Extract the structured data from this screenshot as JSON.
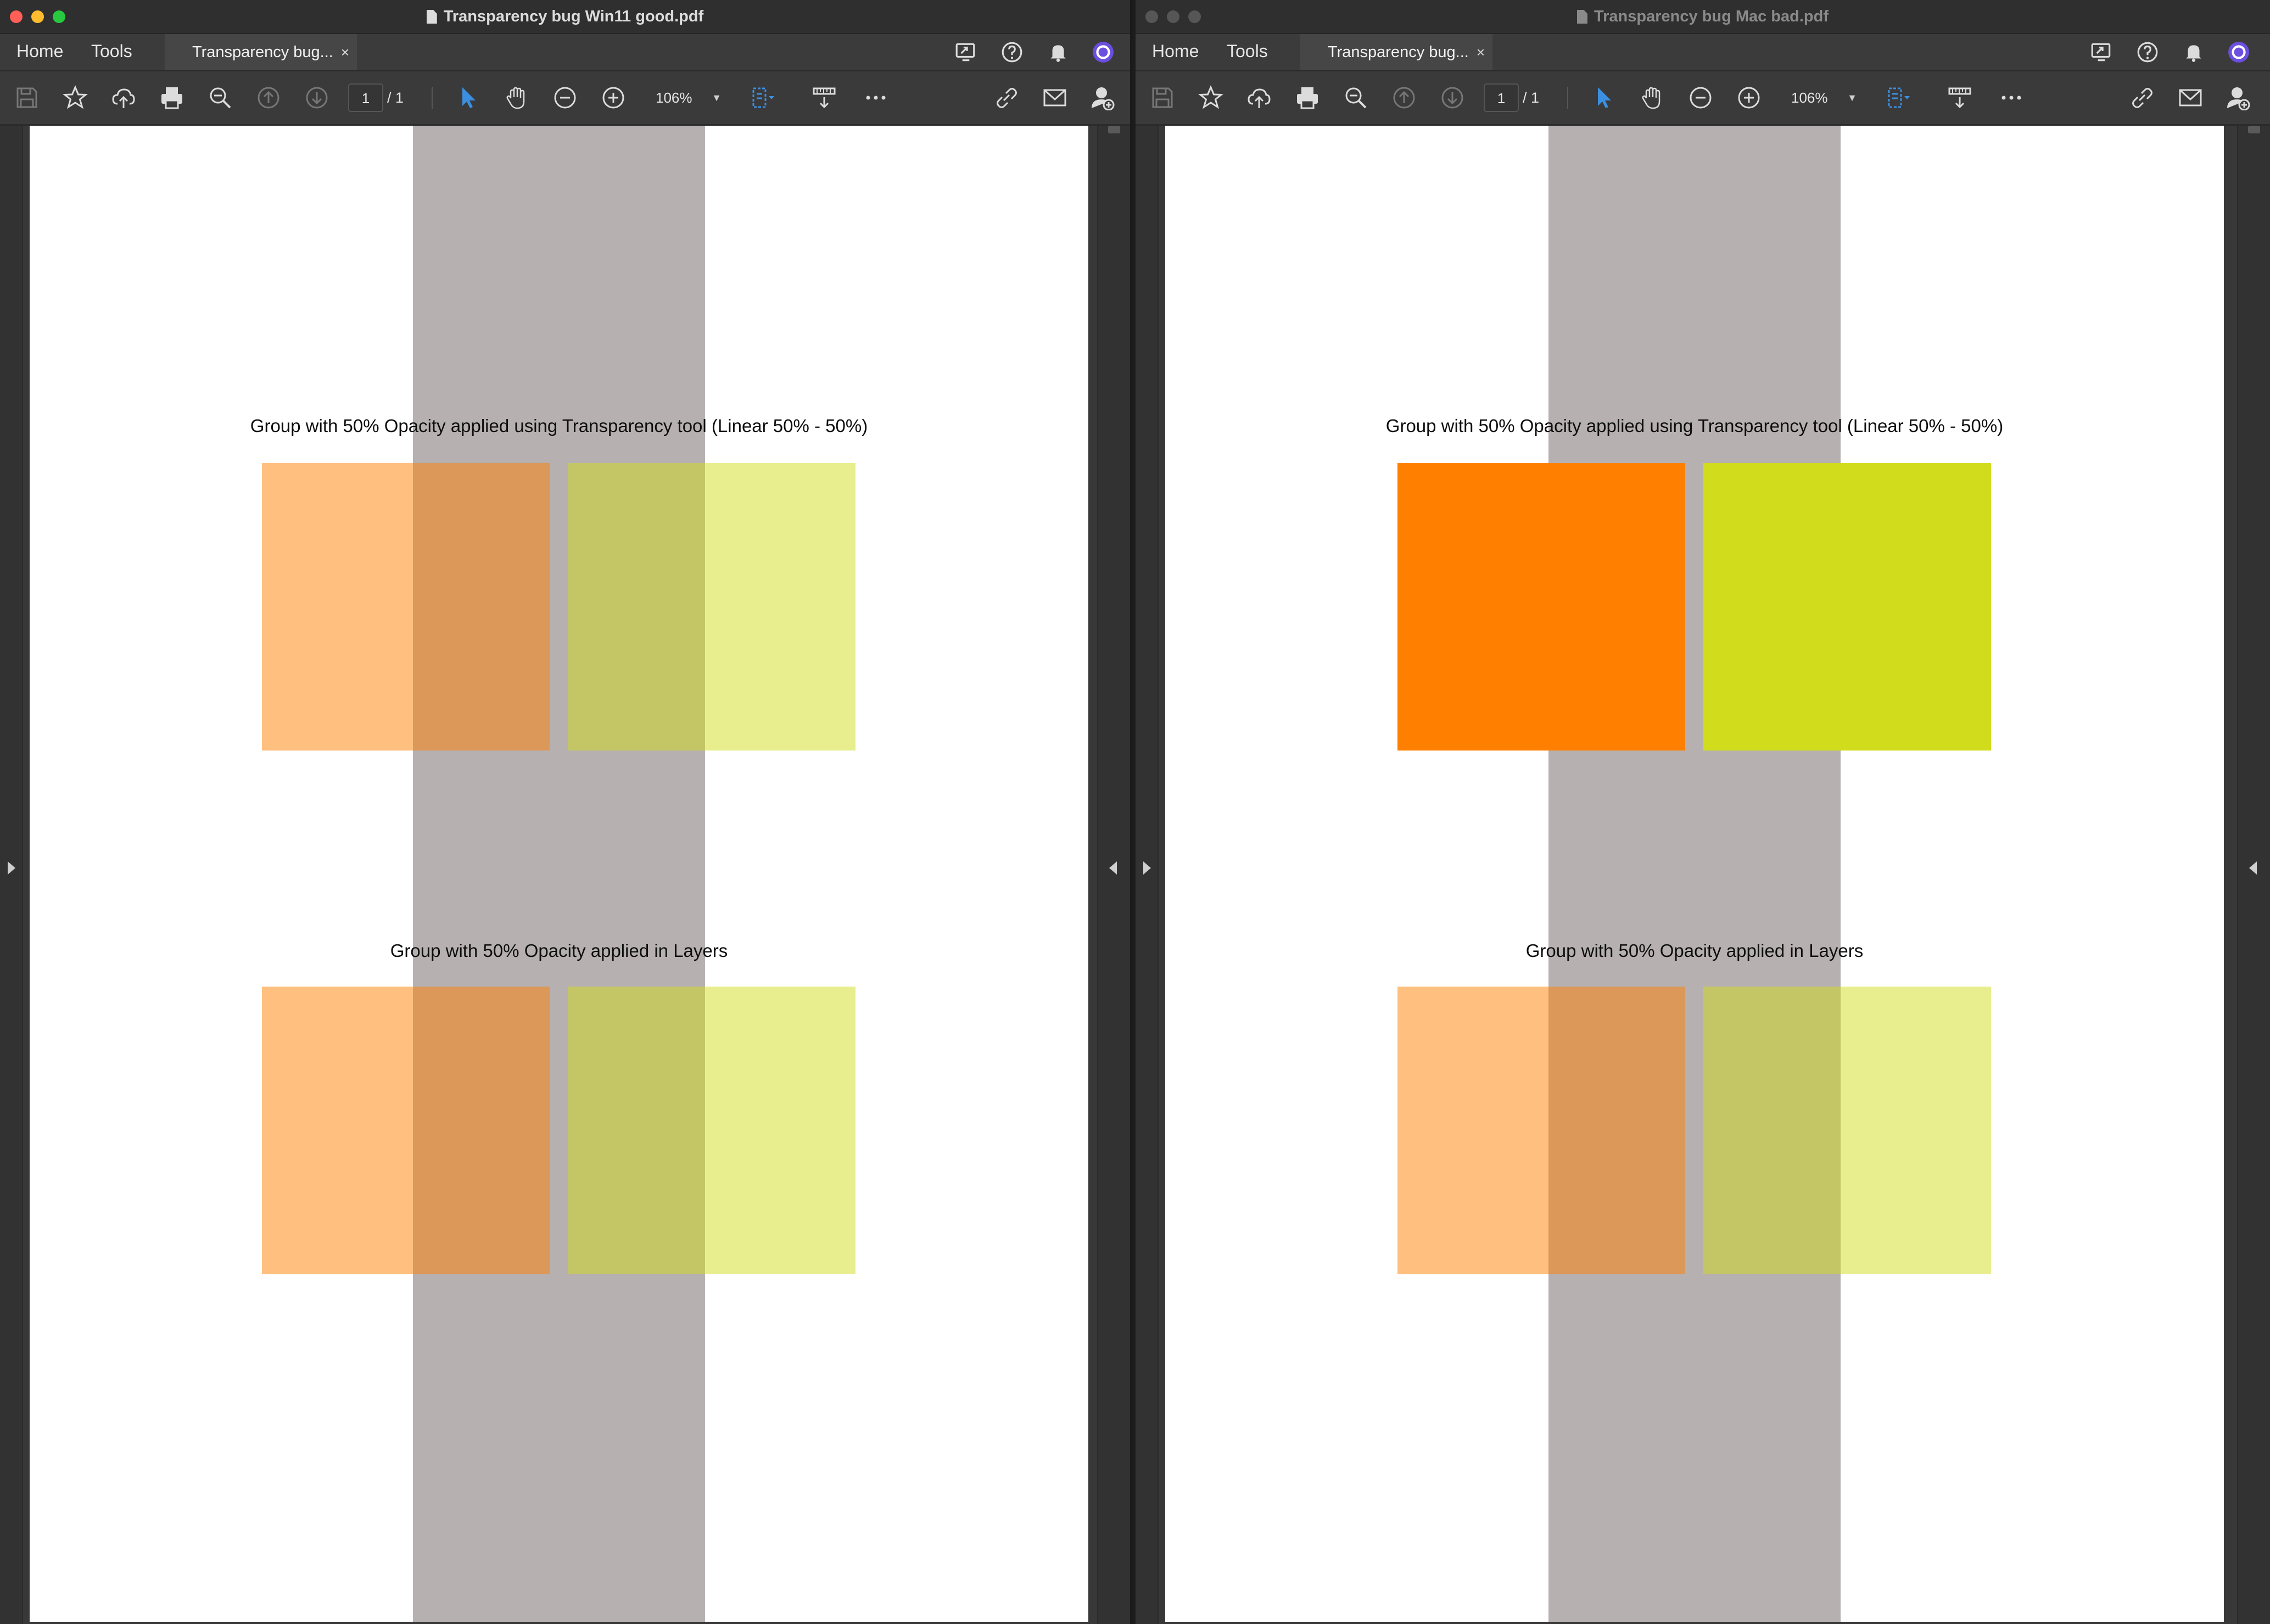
{
  "windows": [
    {
      "id": "left",
      "title": "Transparency bug Win11 good.pdf",
      "nav": {
        "home": "Home",
        "tools": "Tools"
      },
      "tab": {
        "label": "Transparency bug...",
        "close": "×"
      },
      "toolbar": {
        "page_current": "1",
        "page_total": "/ 1",
        "zoom": "106%"
      },
      "doc": {
        "caption_top": "Group with 50% Opacity applied using Transparency tool (Linear 50% - 50%)",
        "caption_bottom": "Group with 50% Opacity applied in Layers"
      },
      "top_group_opacity": 0.5,
      "bottom_group_opacity": 0.5
    },
    {
      "id": "right",
      "title": "Transparency bug Mac bad.pdf",
      "nav": {
        "home": "Home",
        "tools": "Tools"
      },
      "tab": {
        "label": "Transparency bug...",
        "close": "×"
      },
      "toolbar": {
        "page_current": "1",
        "page_total": "/ 1",
        "zoom": "106%"
      },
      "doc": {
        "caption_top": "Group with 50% Opacity applied using Transparency tool (Linear 50% - 50%)",
        "caption_bottom": "Group with 50% Opacity applied in Layers"
      },
      "top_group_opacity": 1,
      "bottom_group_opacity": 0.5
    }
  ],
  "colors": {
    "orange": "#ff8000",
    "yellow": "#d1dc1c",
    "band": "#b6b0b0",
    "accent_blue": "#3c8fe0",
    "avatar": "#6c4ee0"
  },
  "icons": [
    "document-icon",
    "share-screen-icon",
    "help-icon",
    "bell-icon",
    "avatar",
    "save-icon",
    "star-icon",
    "upload-icon",
    "print-icon",
    "zoom-out-magnifier-icon",
    "prev-page-icon",
    "next-page-icon",
    "select-cursor-icon",
    "hand-icon",
    "zoom-minus-icon",
    "zoom-plus-icon",
    "fit-page-icon",
    "scroll-mode-icon",
    "more-icon",
    "link-icon",
    "email-icon",
    "add-user-icon"
  ]
}
